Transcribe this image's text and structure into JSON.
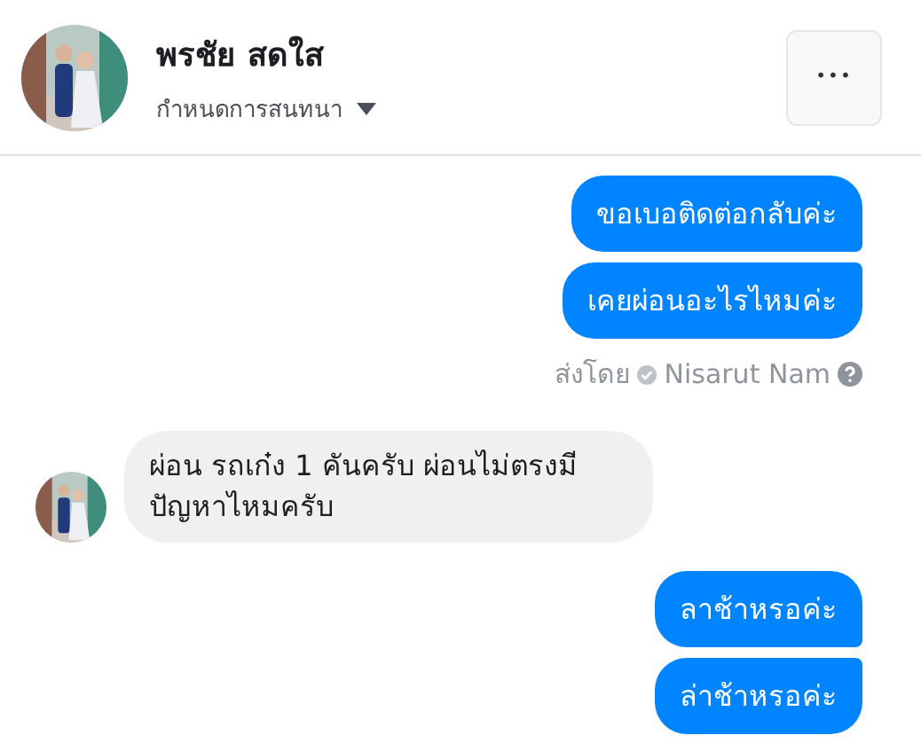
{
  "header": {
    "name": "พรชัย สดใส",
    "subtitle": "กำหนดการสนทนา",
    "more_button": "•••"
  },
  "messages": [
    {
      "kind": "sent",
      "text": "ขอเบอติดต่อกลับค่ะ"
    },
    {
      "kind": "sent",
      "text": "เคยผ่อนอะไรไหมค่ะ"
    },
    {
      "kind": "sent_by",
      "prefix": "ส่งโดย",
      "sender": "Nisarut Nam"
    },
    {
      "kind": "received",
      "text": "ผ่อน รถเก๋ง 1 คันครับ  ผ่อนไม่ตรงมีปัญหาไหมครับ"
    },
    {
      "kind": "sent",
      "text": "ลาช้าหรอค่ะ"
    },
    {
      "kind": "sent",
      "text": "ล่าช้าหรอค่ะ"
    }
  ]
}
